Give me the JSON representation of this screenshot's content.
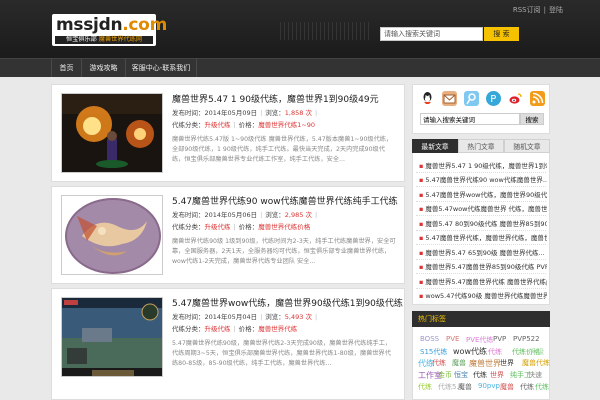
{
  "header": {
    "logo_main": "mssjdn",
    "logo_dot_com": ".com",
    "logo_sub_white": "恒宝俱乐部",
    "logo_sub_yellow": "魔兽世界代练网",
    "top_links": [
      "RSS订阅",
      "登陆"
    ],
    "search_placeholder": "请输入搜索关键词",
    "search_button": "搜 索"
  },
  "nav": [
    "首页",
    "游戏攻略",
    "客服中心-联系我们"
  ],
  "posts": [
    {
      "title": "魔兽世界5.47 1 90级代练，魔兽世界1到90级49元",
      "meta_date_label": "发布时间：",
      "meta_date": "2014年05月09日",
      "meta_views_label": "浏览：",
      "meta_views": "1,858 次",
      "meta_cat_label": "代练分类：",
      "meta_cat": "升级代练",
      "meta_price_label": "价格：",
      "meta_price": "魔兽世界代练1~90",
      "desc": "魔兽世界代练5.47版 1~90级代练 魔兽世界代练，5.47版本魔兽1~90级代练，全部90级代练，1 90级代练，纯手工代练。最快当天完成，2天内完成90级代练，恒宝俱乐部魔兽世界专业代练工作室，纯手工代练，安全..."
    },
    {
      "title": "5.47魔兽世界代练90 wow代练魔兽世界代练纯手工代练",
      "meta_date_label": "发布时间：",
      "meta_date": "2014年05月06日",
      "meta_views_label": "浏览：",
      "meta_views": "2,985 次",
      "meta_cat_label": "代练分类：",
      "meta_cat": "升级代练",
      "meta_price_label": "价格：",
      "meta_price": "魔兽世界代练价格",
      "desc": "魔兽世界代练90级 1级到90级，代练时间为2-3天，纯手工代练魔兽世界，安全可靠，全国服务器，2天1天，全服务器均可代练，恒宝俱乐部专业魔兽世界代练，wow代练1-2天完成，魔兽世界代练专业团队 安全..."
    },
    {
      "title": "5.47魔兽世界wow代练，魔兽世界90级代练1到90级代练",
      "meta_date_label": "发布时间：",
      "meta_date": "2014年05月04日",
      "meta_views_label": "浏览：",
      "meta_views": "5,493 次",
      "meta_cat_label": "代练分类：",
      "meta_cat": "升级代练",
      "meta_price_label": "价格：",
      "meta_price": "魔兽世界代练",
      "desc": "5.47魔兽世界代练90级，魔兽世界代练2-3天完成90级，魔兽世界代练纯手工，代练周期3~5天，恒宝俱乐部魔兽世界代练，魔兽世界代练1-80级，魔兽世界代练80-85级，85-90级代练，纯手工代练，魔兽世界代练..."
    }
  ],
  "sidebar": {
    "search_placeholder": "请输入搜索关键词",
    "search_button": "搜索",
    "tabs": [
      "最新文章",
      "热门文章",
      "随机文章"
    ],
    "recent": [
      "魔兽世界5.47 1 90级代练，魔兽世界1到90...",
      "5.47魔兽世界代练90 wow代练魔兽世界...",
      "5.47魔兽世界wow代练，魔兽世界90级代练1到...",
      "魔兽5.47wow代练魔兽世界 代练，魔兽世界85...",
      "魔兽5.47 80到90级代练 魔兽世界85到90级...",
      "5.47魔兽世界代练，魔兽世界代练，魔兽世界代练...",
      "魔兽世界5.47 65到90级 魔兽世界代练...",
      "魔兽世界5.47魔兽世界85到90级代练 PVP5...",
      "魔兽世界5.47魔兽世界代练 魔兽世界代练pvp...",
      "wow5.47代练90级 魔兽世界代练魔兽世界..."
    ],
    "tags_title": "热门标签",
    "tags": [
      {
        "text": "BOSS",
        "color": "#9a9ad0"
      },
      {
        "text": "PVE",
        "color": "#d37878"
      },
      {
        "text": "PVE代练",
        "color": "#d97fd9"
      },
      {
        "text": "PVP",
        "color": "#666666"
      },
      {
        "text": "PVP522",
        "color": "#666666"
      },
      {
        "text": "S15代练",
        "color": "#3da0d9"
      },
      {
        "text": "wow代练",
        "color": "#333333"
      },
      {
        "text": "代练",
        "color": "#e07ad0"
      },
      {
        "text": "代练价格",
        "color": "#5fbf5f"
      },
      {
        "text": "升级",
        "color": "#9bd39b"
      },
      {
        "text": "代练",
        "color": "#4cb5e0"
      },
      {
        "text": "代练",
        "color": "#d35050"
      },
      {
        "text": "魔兽",
        "color": "#5aa05a"
      },
      {
        "text": "魔兽世界",
        "color": "#c08040"
      },
      {
        "text": "世界",
        "color": "#333333"
      },
      {
        "text": "魔兽代练",
        "color": "#d4a000"
      },
      {
        "text": "工作室",
        "color": "#9b59b6"
      },
      {
        "text": "金币",
        "color": "#7fbf3f"
      },
      {
        "text": "恒宝",
        "color": "#4682b4"
      },
      {
        "text": "代练",
        "color": "#333333"
      },
      {
        "text": "世界",
        "color": "#d35050"
      },
      {
        "text": "纯手工",
        "color": "#5fbf5f"
      },
      {
        "text": "快速",
        "color": "#888888"
      },
      {
        "text": "代练",
        "color": "#9acd32"
      },
      {
        "text": "代练5.4",
        "color": "#b0b0b0"
      },
      {
        "text": "魔兽",
        "color": "#666666"
      },
      {
        "text": "90pvp",
        "color": "#4cb5e0"
      },
      {
        "text": "魔兽",
        "color": "#d35050"
      },
      {
        "text": "代练",
        "color": "#666666"
      },
      {
        "text": "代练",
        "color": "#5fbf5f"
      }
    ]
  }
}
